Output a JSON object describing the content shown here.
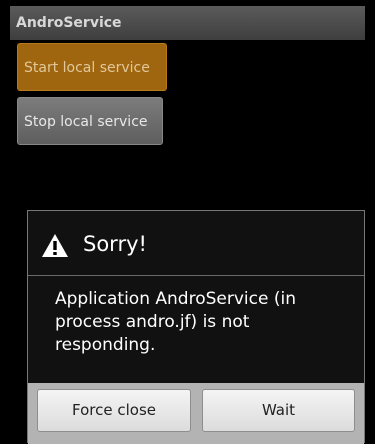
{
  "app": {
    "title": "AndroService"
  },
  "main": {
    "start_label": "Start local service",
    "stop_label": "Stop local service"
  },
  "dialog": {
    "icon": "warning-icon",
    "title": "Sorry!",
    "message": "Application AndroService (in process andro.jf) is not responding.",
    "buttons": {
      "force_close": "Force close",
      "wait": "Wait"
    }
  },
  "colors": {
    "background": "#000000",
    "start_button": "#a0660f",
    "stop_button": "#6c6c6c",
    "dialog_background": "#111111",
    "dialog_button_bar": "#b3b3b3"
  }
}
